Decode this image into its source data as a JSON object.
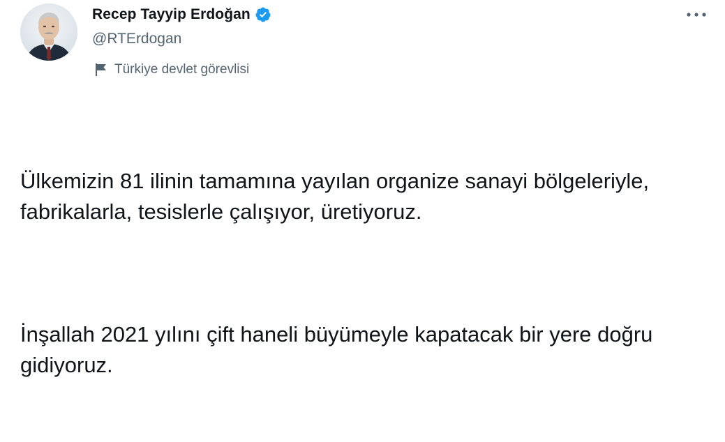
{
  "author": {
    "display_name": "Recep Tayyip Erdoğan",
    "handle": "@RTErdogan",
    "verified_icon": "verified-badge-icon",
    "label_icon": "flag-icon",
    "label": "Türkiye devlet görevlisi",
    "avatar_icon": "avatar-portrait"
  },
  "menu": {
    "more_icon": "more-dots-icon"
  },
  "tweet": {
    "paragraph_1": "Ülkemizin 81 ilinin tamamına yayılan organize sanayi bölgeleriyle, fabrikalarla, tesislerle çalışıyor, üretiyoruz.",
    "paragraph_2": "İnşallah 2021 yılını çift haneli büyümeyle kapatacak bir yere doğru gidiyoruz."
  },
  "colors": {
    "text": "#0f1419",
    "secondary_text": "#536471",
    "verified_blue": "#1d9bf0",
    "background": "#ffffff"
  }
}
